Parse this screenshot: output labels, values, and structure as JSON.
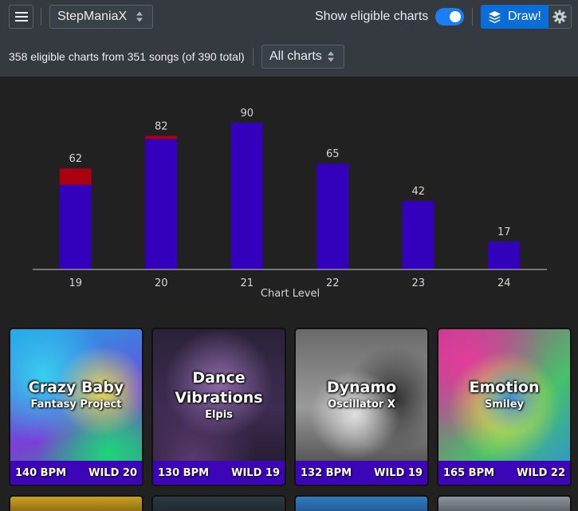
{
  "header": {
    "menu_icon": "hamburger-menu-icon",
    "game_select": "StepManiaX",
    "toggle_label": "Show eligible charts",
    "toggle_on": true,
    "draw_label": "Draw!",
    "draw_icon": "stack-layers-icon",
    "settings_icon": "gear-icon",
    "summary": "358 eligible charts from 351 songs (of 390 total)",
    "filter_select": "All charts"
  },
  "colors": {
    "accent": "#1c7ef5",
    "draw_button": "#0b6dd8",
    "bar_primary": "#3300bb",
    "bar_highlight": "#aa0011",
    "card_footer": "#3c06b8"
  },
  "chart_data": {
    "type": "bar",
    "xlabel": "Chart Level",
    "categories": [
      "19",
      "20",
      "21",
      "22",
      "23",
      "24"
    ],
    "totals": [
      62,
      82,
      90,
      65,
      42,
      17
    ],
    "series": [
      {
        "values": [
          52,
          80,
          90,
          65,
          42,
          17
        ],
        "color": "#3300bb"
      },
      {
        "values": [
          10,
          2,
          0,
          0,
          0,
          0
        ],
        "color": "#aa0011"
      }
    ],
    "ylim": [
      0,
      90
    ],
    "grid": false
  },
  "songs": [
    {
      "title": "Crazy Baby",
      "artist": "Fantasy Project",
      "bpm": "140 BPM",
      "level": "WILD 20"
    },
    {
      "title": "Dance Vibrations",
      "artist": "Elpis",
      "bpm": "130 BPM",
      "level": "WILD 19"
    },
    {
      "title": "Dynamo",
      "artist": "Oscillator X",
      "bpm": "132 BPM",
      "level": "WILD 19"
    },
    {
      "title": "Emotion",
      "artist": "Smiley",
      "bpm": "165 BPM",
      "level": "WILD 22"
    }
  ]
}
